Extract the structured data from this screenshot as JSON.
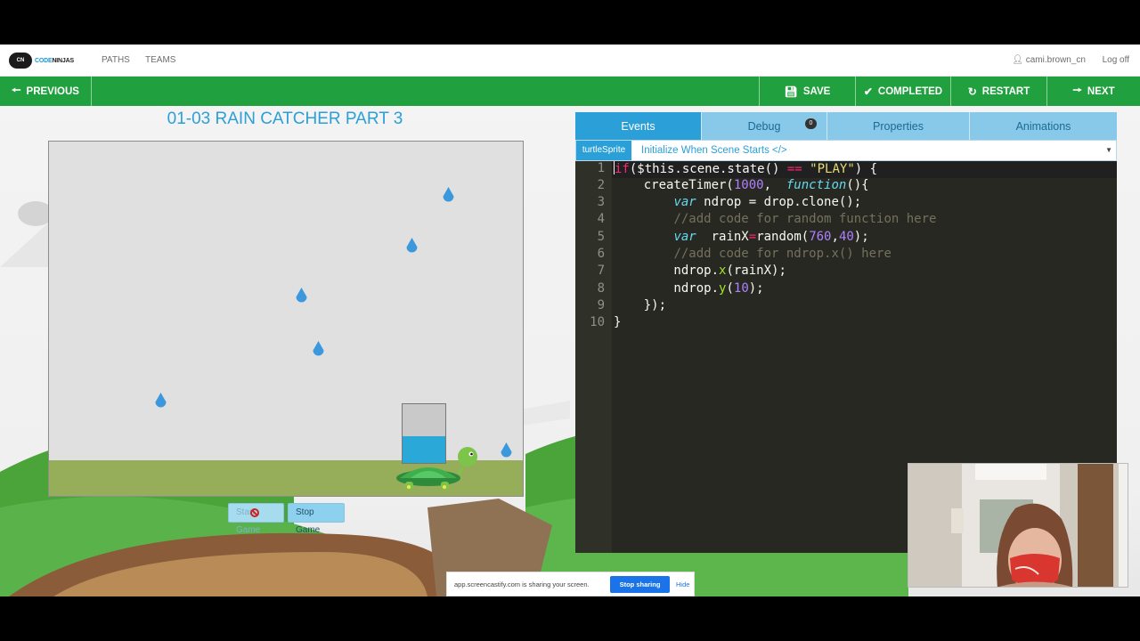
{
  "topbar": {
    "logo_badge": "CN",
    "logo_brand_a": "CODE",
    "logo_brand_b": "NINJAS",
    "nav": [
      "PATHS",
      "TEAMS"
    ],
    "user": "cami.brown_cn",
    "logoff": "Log off"
  },
  "toolbar": {
    "previous": "PREVIOUS",
    "save": "SAVE",
    "completed": "COMPLETED",
    "restart": "RESTART",
    "next": "NEXT",
    "accent": "#21a03f"
  },
  "activity": {
    "title": "01-03 RAIN CATCHER PART 3",
    "start_button": "Start Game",
    "stop_button": "Stop Game"
  },
  "editor": {
    "tabs": [
      "Events",
      "Debug",
      "Properties",
      "Animations"
    ],
    "active_tab": "Events",
    "debug_count": "0",
    "sprite": "turtleSprite",
    "event": "Initialize When Scene Starts </>",
    "line_numbers": [
      "1",
      "2",
      "3",
      "4",
      "5",
      "6",
      "7",
      "8",
      "9",
      "10"
    ]
  },
  "share": {
    "message": "app.screencastify.com is sharing your screen.",
    "stop": "Stop sharing",
    "hide": "Hide"
  }
}
